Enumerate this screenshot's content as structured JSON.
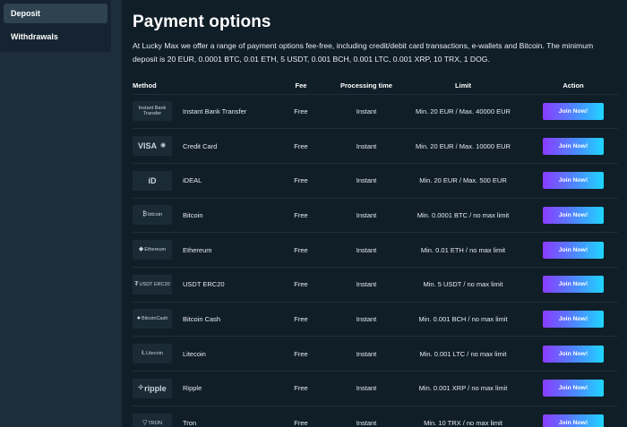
{
  "sidebar": {
    "items": [
      {
        "label": "Deposit"
      },
      {
        "label": "Withdrawals"
      }
    ]
  },
  "main": {
    "title": "Payment options",
    "description": "At Lucky Max we offer a range of payment options fee-free, including credit/debit card transactions, e-wallets and Bitcoin. The minimum deposit is 20 EUR, 0.0001 BTC, 0.01 ETH, 5 USDT, 0.001 BCH, 0.001 LTC, 0.001 XRP, 10 TRX, 1 DOG."
  },
  "table": {
    "headers": {
      "method": "Method",
      "fee": "Fee",
      "processing": "Processing time",
      "limit": "Limit",
      "action": "Action"
    },
    "rows": [
      {
        "logo_text": "Instant Bank Transfer",
        "logo_icon": "bank-transfer-logo",
        "method": "Instant Bank Transfer",
        "fee": "Free",
        "time": "Instant",
        "limit": "Min. 20 EUR / Max. 40000 EUR",
        "action": "Join Now!"
      },
      {
        "logo_text": "VISA",
        "logo_icon": "visa-mastercard-logo",
        "method": "Credit Card",
        "fee": "Free",
        "time": "Instant",
        "limit": "Min. 20 EUR / Max. 10000 EUR",
        "action": "Join Now!"
      },
      {
        "logo_text": "iD",
        "logo_icon": "ideal-logo",
        "method": "iDEAL",
        "fee": "Free",
        "time": "Instant",
        "limit": "Min. 20 EUR / Max. 500 EUR",
        "action": "Join Now!"
      },
      {
        "logo_text": "bitcoin",
        "logo_icon": "bitcoin-logo",
        "method": "Bitcoin",
        "fee": "Free",
        "time": "Instant",
        "limit": "Min. 0.0001 BTC / no max limit",
        "action": "Join Now!"
      },
      {
        "logo_text": "Ethereum",
        "logo_icon": "ethereum-logo",
        "method": "Ethereum",
        "fee": "Free",
        "time": "Instant",
        "limit": "Min. 0.01 ETH / no max limit",
        "action": "Join Now!"
      },
      {
        "logo_text": "USDT ERC20",
        "logo_icon": "usdt-logo",
        "method": "USDT ERC20",
        "fee": "Free",
        "time": "Instant",
        "limit": "Min. 5 USDT / no max limit",
        "action": "Join Now!"
      },
      {
        "logo_text": "BitcoinCash",
        "logo_icon": "bitcoin-cash-logo",
        "method": "Bitcoin Cash",
        "fee": "Free",
        "time": "Instant",
        "limit": "Min. 0.001 BCH / no max limit",
        "action": "Join Now!"
      },
      {
        "logo_text": "Litecoin",
        "logo_icon": "litecoin-logo",
        "method": "Litecoin",
        "fee": "Free",
        "time": "Instant",
        "limit": "Min. 0.001 LTC / no max limit",
        "action": "Join Now!"
      },
      {
        "logo_text": "ripple",
        "logo_icon": "ripple-logo",
        "method": "Ripple",
        "fee": "Free",
        "time": "Instant",
        "limit": "Min. 0.001 XRP / no max limit",
        "action": "Join Now!"
      },
      {
        "logo_text": "TRON",
        "logo_icon": "tron-logo",
        "method": "Tron",
        "fee": "Free",
        "time": "Instant",
        "limit": "Min. 10 TRX / no max limit",
        "action": "Join Now!"
      }
    ]
  },
  "colors": {
    "background": "#1d2e3a",
    "panel": "#101e28",
    "sidebar": "#152430",
    "button_gradient_start": "#8a3bff",
    "button_gradient_end": "#1fd6ff"
  }
}
